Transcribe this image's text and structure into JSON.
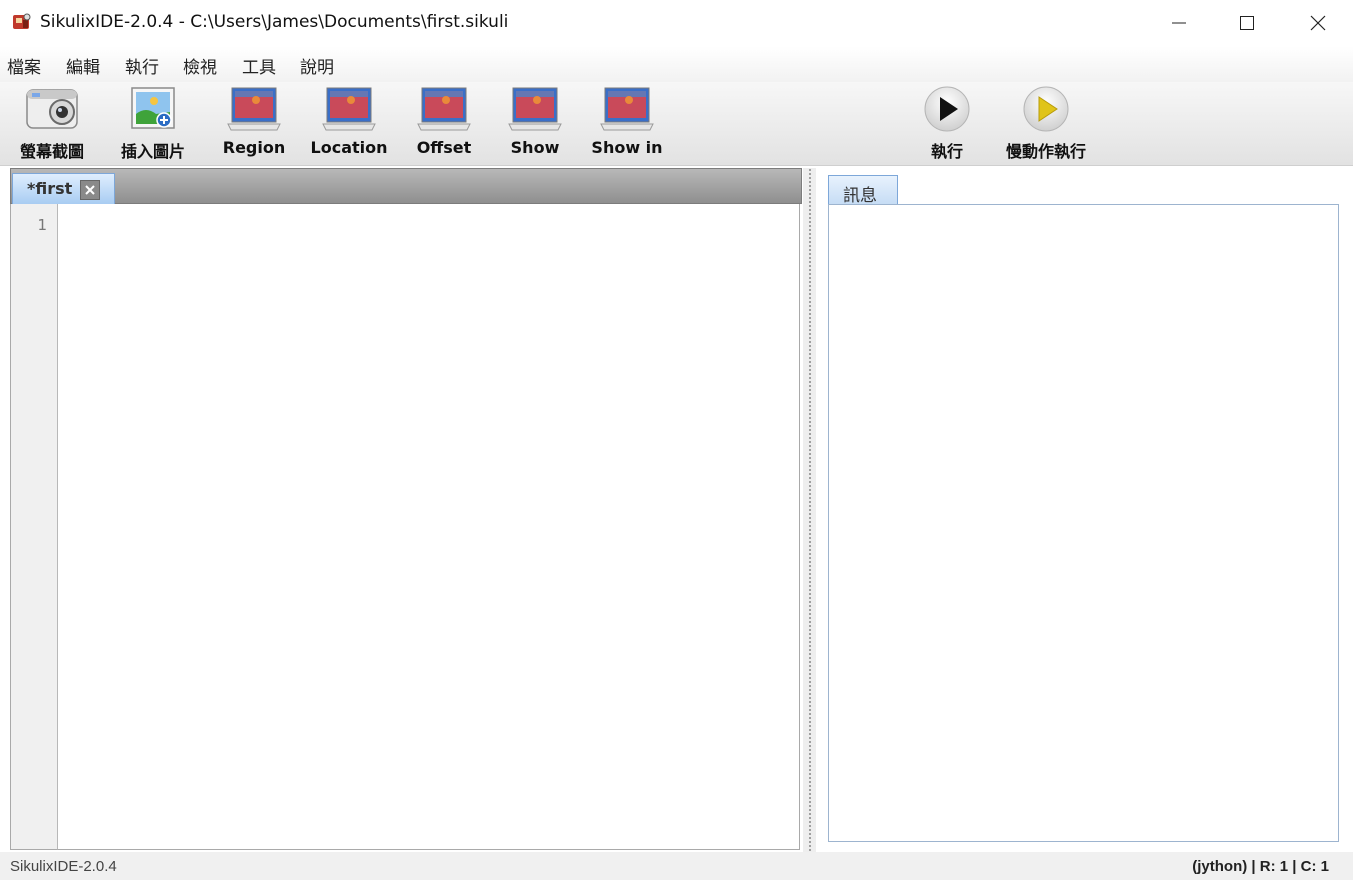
{
  "window": {
    "title": "SikulixIDE-2.0.4 - C:\\Users\\James\\Documents\\first.sikuli",
    "app_icon": "sikulix-app-icon",
    "controls": {
      "minimize_icon": "minimize-icon",
      "maximize_icon": "maximize-icon",
      "close_icon": "close-icon"
    }
  },
  "menu": {
    "items": [
      "檔案",
      "編輯",
      "執行",
      "檢視",
      "工具",
      "說明"
    ]
  },
  "toolbar": {
    "buttons": [
      {
        "label": "螢幕截圖",
        "icon": "camera-icon"
      },
      {
        "label": "插入圖片",
        "icon": "insert-image-icon"
      },
      {
        "label": "Region",
        "icon": "screen-region-icon"
      },
      {
        "label": "Location",
        "icon": "screen-location-icon"
      },
      {
        "label": "Offset",
        "icon": "screen-offset-icon"
      },
      {
        "label": "Show",
        "icon": "screen-show-icon"
      },
      {
        "label": "Show in",
        "icon": "screen-show-in-icon"
      },
      {
        "label": "執行",
        "icon": "run-icon"
      },
      {
        "label": "慢動作執行",
        "icon": "run-slow-icon"
      }
    ]
  },
  "editor": {
    "tab_label": "*first",
    "tab_close_icon": "tab-close-icon",
    "line_numbers": [
      "1"
    ],
    "content": ""
  },
  "messages": {
    "tab_label": "訊息",
    "content": ""
  },
  "status": {
    "left": "SikulixIDE-2.0.4",
    "right": "(jython) | R: 1 | C: 1"
  },
  "colors": {
    "tab_active": "#a8ccf2",
    "tab_border": "#7da7d9",
    "run_icon": "#111111",
    "run_slow_icon": "#e0c419"
  }
}
